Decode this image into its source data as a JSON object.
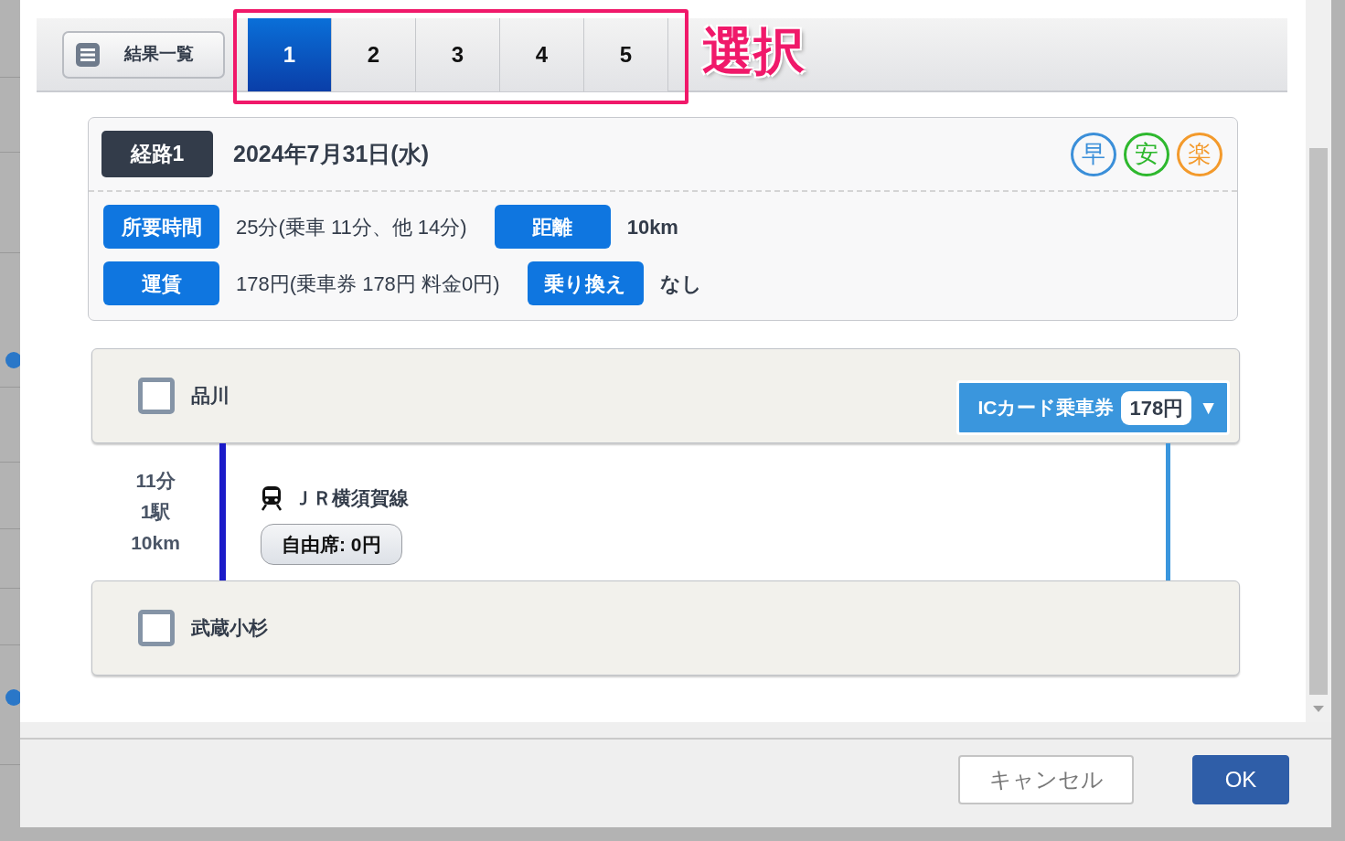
{
  "toolbar": {
    "list_button": "結果一覧",
    "tabs": [
      {
        "label": "1",
        "selected": true
      },
      {
        "label": "2",
        "selected": false
      },
      {
        "label": "3",
        "selected": false
      },
      {
        "label": "4",
        "selected": false
      },
      {
        "label": "5",
        "selected": false
      }
    ],
    "annotation": "選択"
  },
  "route": {
    "badge": "経路1",
    "date": "2024年7月31日(水)",
    "marks": [
      {
        "label": "早",
        "color": "#3b8fd9"
      },
      {
        "label": "安",
        "color": "#2eb82e"
      },
      {
        "label": "楽",
        "color": "#f39a2c"
      }
    ],
    "fact_rows": [
      [
        {
          "label": "所要時間",
          "value": "25分(乗車 11分、他 14分)"
        },
        {
          "label": "距離",
          "value": "10km"
        }
      ],
      [
        {
          "label": "運賃",
          "value": "178円(乗車券 178円 料金0円)"
        },
        {
          "label": "乗り換え",
          "value": "なし"
        }
      ]
    ]
  },
  "stations": [
    {
      "name": "品川",
      "checked": false,
      "fare": {
        "label": "ICカード乗車券",
        "amount": "178円",
        "caret": "▼"
      }
    },
    {
      "name": "武蔵小杉",
      "checked": false
    }
  ],
  "segment": {
    "time": "11分",
    "stops": "1駅",
    "distance": "10km",
    "line": "ＪＲ横須賀線",
    "seat": "自由席: 0円"
  },
  "buttons": [
    {
      "label": "キャンセル",
      "kind": "secondary"
    },
    {
      "label": "OK",
      "kind": "primary"
    }
  ]
}
